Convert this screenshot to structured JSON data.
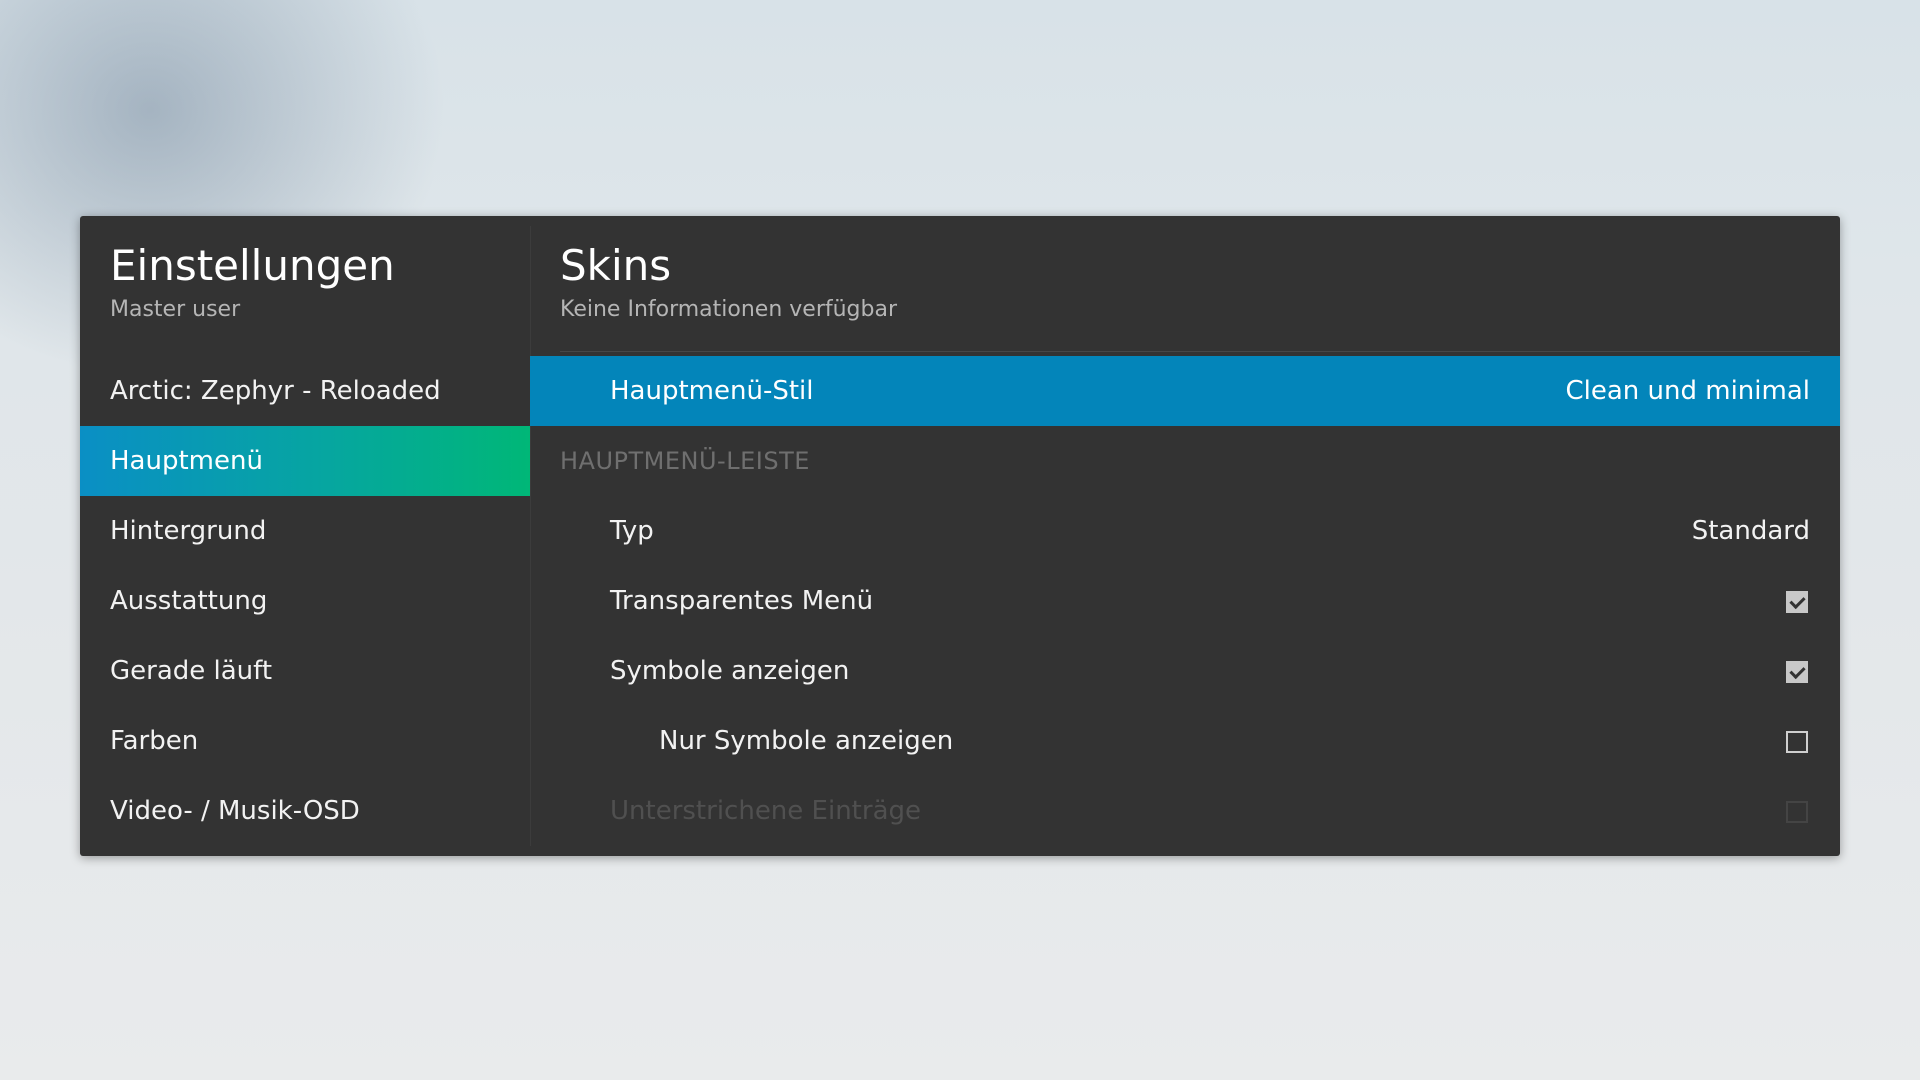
{
  "sidebar": {
    "title": "Einstellungen",
    "subtitle": "Master user",
    "items": [
      {
        "label": "Arctic: Zephyr - Reloaded"
      },
      {
        "label": "Hauptmenü"
      },
      {
        "label": "Hintergrund"
      },
      {
        "label": "Ausstattung"
      },
      {
        "label": "Gerade läuft"
      },
      {
        "label": "Farben"
      },
      {
        "label": "Video- / Musik-OSD"
      }
    ],
    "active_item": "Hauptmenü"
  },
  "main": {
    "title": "Skins",
    "subtitle": "Keine Informationen verfügbar",
    "rows": {
      "main_menu_style": {
        "label": "Hauptmenü-Stil",
        "value": "Clean und minimal"
      },
      "section_header": {
        "label": "HAUPTMENÜ-LEISTE"
      },
      "type": {
        "label": "Typ",
        "value": "Standard"
      },
      "transparent_menu": {
        "label": "Transparentes Menü",
        "checked": true
      },
      "show_icons": {
        "label": "Symbole anzeigen",
        "checked": true
      },
      "show_only_icons": {
        "label": "Nur Symbole anzeigen",
        "checked": false
      },
      "underlined_entries": {
        "label": "Unterstrichene Einträge",
        "checked": false,
        "disabled": true
      }
    }
  },
  "colors": {
    "panel_bg": "#333333",
    "focus_blue": "#0385ba",
    "active_gradient_start": "#0a8fc5",
    "active_gradient_end": "#00b777"
  }
}
